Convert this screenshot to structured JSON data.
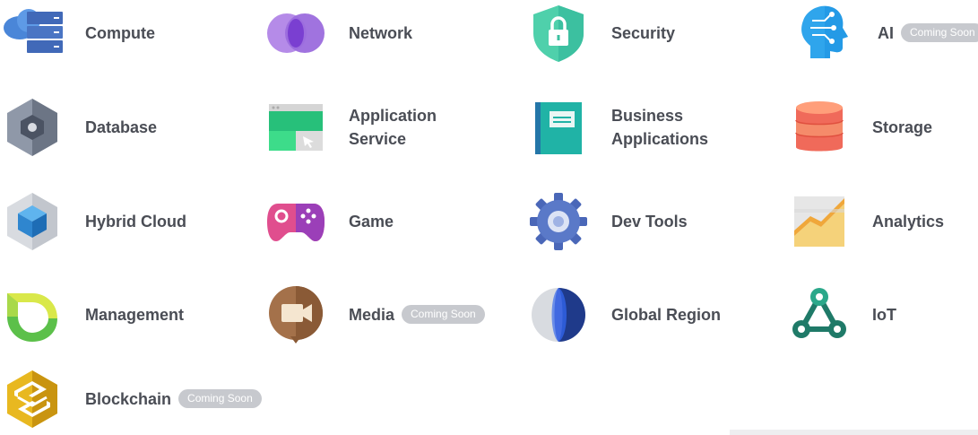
{
  "products": [
    {
      "key": "compute",
      "label": "Compute",
      "icon": "compute-server-icon"
    },
    {
      "key": "network",
      "label": "Network",
      "icon": "network-rings-icon"
    },
    {
      "key": "security",
      "label": "Security",
      "icon": "security-shield-lock-icon"
    },
    {
      "key": "ai",
      "label": "AI",
      "badge": "Coming Soon",
      "icon": "ai-head-icon"
    },
    {
      "key": "database",
      "label": "Database",
      "icon": "database-hexagon-icon"
    },
    {
      "key": "application-service",
      "label_line1": "Application",
      "label_line2": "Service",
      "icon": "application-window-icon"
    },
    {
      "key": "business-applications",
      "label_line1": "Business",
      "label_line2": "Applications",
      "icon": "business-book-icon"
    },
    {
      "key": "storage",
      "label": "Storage",
      "icon": "storage-cylinder-icon"
    },
    {
      "key": "hybrid-cloud",
      "label": "Hybrid Cloud",
      "icon": "hybrid-cloud-cube-icon"
    },
    {
      "key": "game",
      "label": "Game",
      "icon": "gamepad-icon"
    },
    {
      "key": "dev-tools",
      "label": "Dev Tools",
      "icon": "gear-icon"
    },
    {
      "key": "analytics",
      "label": "Analytics",
      "icon": "analytics-chart-icon"
    },
    {
      "key": "management",
      "label": "Management",
      "icon": "management-cycle-icon"
    },
    {
      "key": "media",
      "label": "Media",
      "badge": "Coming Soon",
      "icon": "media-camera-icon"
    },
    {
      "key": "global-region",
      "label": "Global Region",
      "icon": "globe-icon"
    },
    {
      "key": "iot",
      "label": "IoT",
      "icon": "iot-network-icon"
    },
    {
      "key": "blockchain",
      "label": "Blockchain",
      "badge": "Coming Soon",
      "icon": "blockchain-hexagon-icon"
    }
  ],
  "colors": {
    "label": "#4a4d55",
    "badge_bg": "#c7c9ce",
    "badge_text": "#ffffff"
  }
}
